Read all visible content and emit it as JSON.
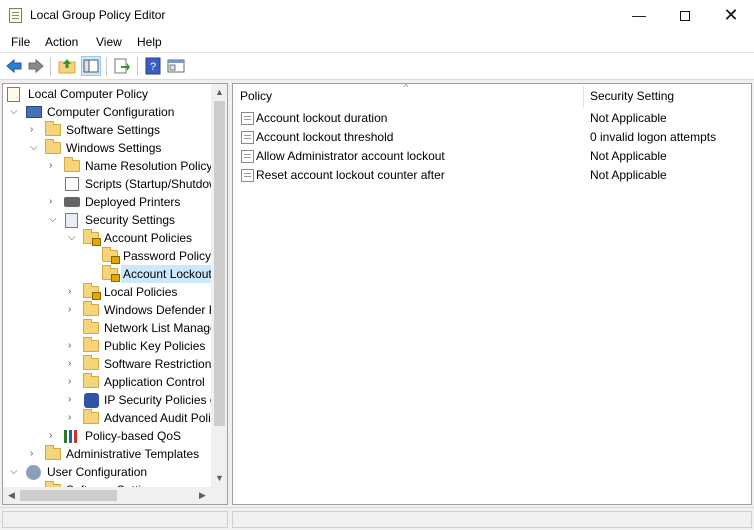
{
  "window": {
    "title": "Local Group Policy Editor",
    "controls": {
      "minimize": "—",
      "close": "✕"
    }
  },
  "menu": [
    "File",
    "Action",
    "View",
    "Help"
  ],
  "toolbar": {
    "back_icon": "back-arrow-icon",
    "forward_icon": "forward-arrow-icon",
    "up_icon": "up-folder-icon",
    "show_hide_tree_icon": "console-tree-icon",
    "export_icon": "export-list-icon",
    "help_icon": "help-icon",
    "properties_icon": "properties-icon"
  },
  "tree": [
    {
      "label": "Local Computer Policy",
      "chevron": ""
    },
    {
      "label": "Computer Configuration",
      "chevron": "⌵"
    },
    {
      "label": "Software Settings",
      "chevron": "›"
    },
    {
      "label": "Windows Settings",
      "chevron": "⌵"
    },
    {
      "label": "Name Resolution Policy",
      "chevron": "›"
    },
    {
      "label": "Scripts (Startup/Shutdown)",
      "chevron": ""
    },
    {
      "label": "Deployed Printers",
      "chevron": "›"
    },
    {
      "label": "Security Settings",
      "chevron": "⌵"
    },
    {
      "label": "Account Policies",
      "chevron": "⌵"
    },
    {
      "label": "Password Policy",
      "chevron": ""
    },
    {
      "label": "Account Lockout Policy",
      "chevron": ""
    },
    {
      "label": "Local Policies",
      "chevron": "›"
    },
    {
      "label": "Windows Defender Firewall",
      "chevron": "›"
    },
    {
      "label": "Network List Manager",
      "chevron": ""
    },
    {
      "label": "Public Key Policies",
      "chevron": "›"
    },
    {
      "label": "Software Restriction",
      "chevron": "›"
    },
    {
      "label": "Application Control",
      "chevron": "›"
    },
    {
      "label": "IP Security Policies o",
      "chevron": "›"
    },
    {
      "label": "Advanced Audit Poli",
      "chevron": "›"
    },
    {
      "label": "Policy-based QoS",
      "chevron": "›"
    },
    {
      "label": "Administrative Templates",
      "chevron": "›"
    },
    {
      "label": "User Configuration",
      "chevron": "⌵"
    },
    {
      "label": "Software Settings",
      "chevron": "›"
    }
  ],
  "selected_tree_item": "Account Lockout Policy",
  "scroll": {
    "up": "▲",
    "down": "▼",
    "left": "◀",
    "right": "▶"
  },
  "list": {
    "columns": [
      "Policy",
      "Security Setting"
    ],
    "sort_indicator": "^",
    "rows": [
      {
        "policy": "Account lockout duration",
        "setting": "Not Applicable"
      },
      {
        "policy": "Account lockout threshold",
        "setting": "0 invalid logon attempts"
      },
      {
        "policy": "Allow Administrator account lockout",
        "setting": "Not Applicable"
      },
      {
        "policy": "Reset account lockout counter after",
        "setting": "Not Applicable"
      }
    ]
  }
}
